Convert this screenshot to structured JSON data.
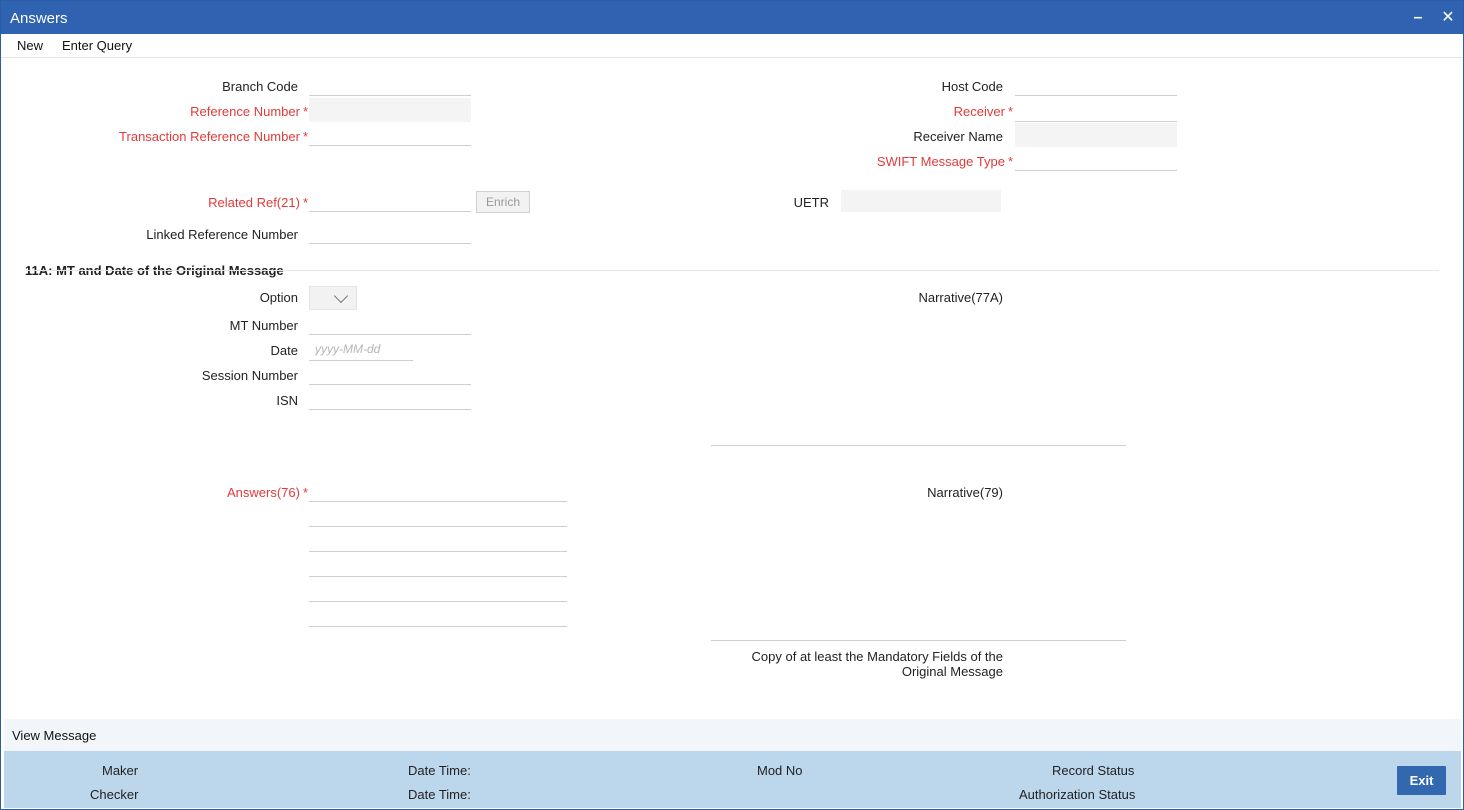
{
  "window": {
    "title": "Answers",
    "minimize": "–",
    "close": "✕"
  },
  "menu": {
    "new": "New",
    "enter_query": "Enter Query"
  },
  "form": {
    "branch_code": "Branch Code",
    "reference_number": "Reference Number",
    "transaction_reference_number": "Transaction Reference Number",
    "host_code": "Host Code",
    "receiver": "Receiver",
    "receiver_name": "Receiver Name",
    "swift_message_type": "SWIFT Message Type",
    "related_ref": "Related Ref(21)",
    "enrich": "Enrich",
    "uetr": "UETR",
    "linked_reference_number": "Linked Reference Number",
    "required_mark": "*"
  },
  "section_11a": {
    "title": "11A: MT and Date of the Original Message",
    "option": "Option",
    "mt_number": "MT Number",
    "date": "Date",
    "date_placeholder": "yyyy-MM-dd",
    "session_number": "Session Number",
    "isn": "ISN"
  },
  "narratives": {
    "narrative_77a": "Narrative(77A)",
    "answers_76": "Answers(76)",
    "narrative_79": "Narrative(79)",
    "copy_line1": "Copy of at least the Mandatory Fields of the",
    "copy_line2": "Original Message"
  },
  "view_message": "View Message",
  "footer": {
    "maker": "Maker",
    "checker": "Checker",
    "date_time_1": "Date Time:",
    "date_time_2": "Date Time:",
    "mod_no": "Mod No",
    "record_status": "Record Status",
    "authorization_status": "Authorization Status",
    "exit": "Exit"
  }
}
